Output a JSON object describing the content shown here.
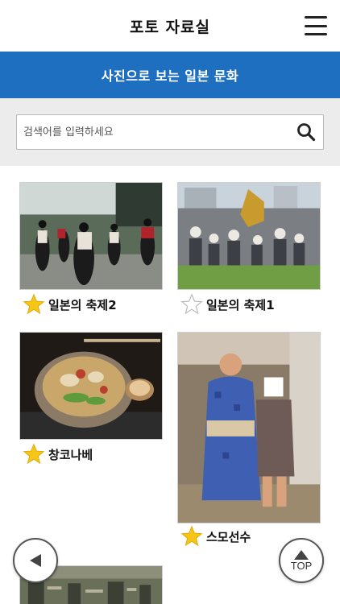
{
  "header": {
    "title": "포토 자료실",
    "menu_icon": "hamburger-menu-icon"
  },
  "banner": {
    "text": "사진으로 보는 일본 문화"
  },
  "search": {
    "placeholder": "검색어를 입력하세요",
    "value": "",
    "icon": "search-icon"
  },
  "colors": {
    "banner": "#1e6fbf",
    "star_filled": "#f5c518",
    "star_empty": "#ffffff"
  },
  "photos": [
    {
      "label": "일본의 축제2",
      "favorited": true
    },
    {
      "label": "일본의 축제1",
      "favorited": false
    },
    {
      "label": "창코나베",
      "favorited": true
    },
    {
      "label": "스모선수",
      "favorited": true
    }
  ],
  "controls": {
    "back_icon": "left-arrow-icon",
    "top_label": "TOP",
    "top_icon": "up-arrow-icon"
  }
}
